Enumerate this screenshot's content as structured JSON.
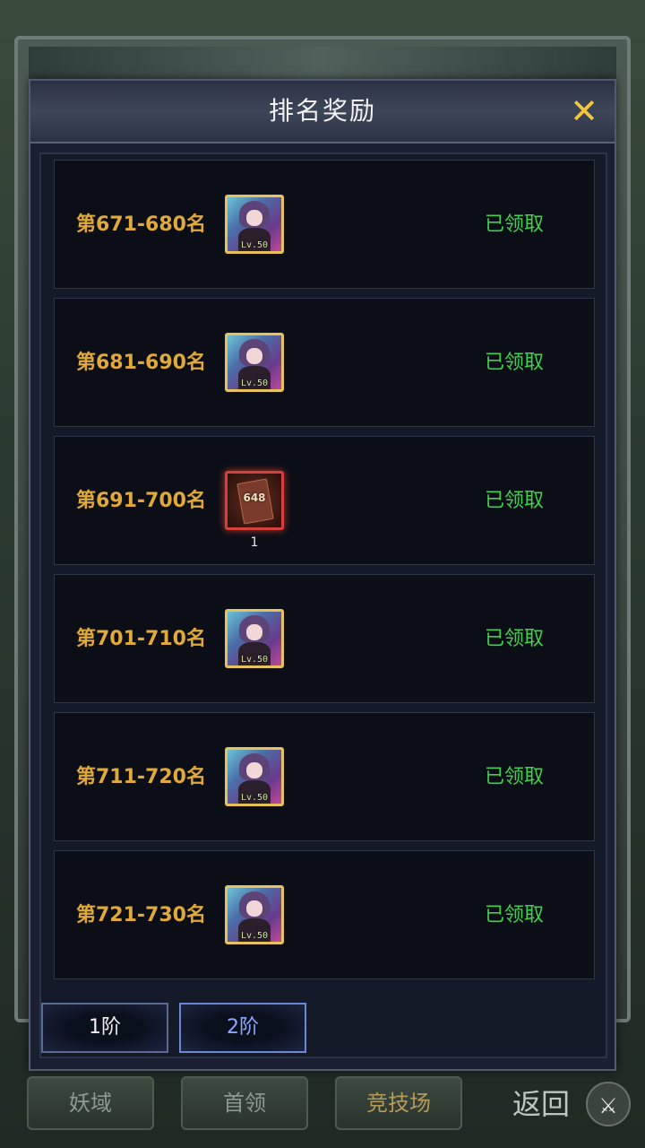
{
  "dialog": {
    "title": "排名奖励",
    "close_icon": "✕"
  },
  "rows": [
    {
      "rank": "第671-680名",
      "item_type": "hero",
      "item_level": "Lv.50",
      "quantity": "",
      "status": "已领取"
    },
    {
      "rank": "第681-690名",
      "item_type": "hero",
      "item_level": "Lv.50",
      "quantity": "",
      "status": "已领取"
    },
    {
      "rank": "第691-700名",
      "item_type": "card",
      "item_level": "648",
      "quantity": "1",
      "status": "已领取"
    },
    {
      "rank": "第701-710名",
      "item_type": "hero",
      "item_level": "Lv.50",
      "quantity": "",
      "status": "已领取"
    },
    {
      "rank": "第711-720名",
      "item_type": "hero",
      "item_level": "Lv.50",
      "quantity": "",
      "status": "已领取"
    },
    {
      "rank": "第721-730名",
      "item_type": "hero",
      "item_level": "Lv.50",
      "quantity": "",
      "status": "已领取"
    }
  ],
  "tabs": [
    {
      "label": "1阶",
      "active": false
    },
    {
      "label": "2阶",
      "active": true
    }
  ],
  "bottom_nav": {
    "items": [
      "妖域",
      "首领",
      "竞技场"
    ],
    "back_label": "返回",
    "back_icon": "swords-icon"
  },
  "colors": {
    "rank_text": "#e0a93a",
    "status_text": "#3fd24a",
    "close_icon": "#f3c63c",
    "active_tab_text": "#8aa8ff"
  }
}
